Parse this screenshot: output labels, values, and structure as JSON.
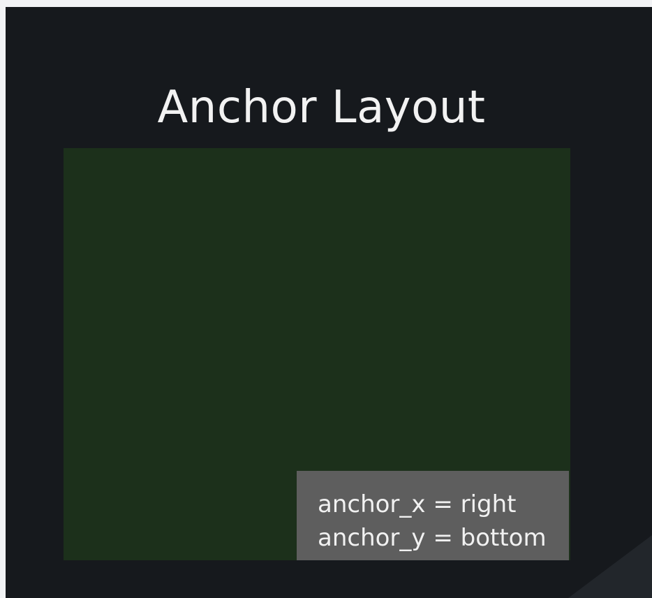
{
  "title": "Anchor Layout",
  "anchored_widget": {
    "line1": "anchor_x = right",
    "line2": "anchor_y = bottom"
  },
  "colors": {
    "window_background": "#16191d",
    "anchor_area_background": "#1c301b",
    "label_box_background": "#5e5e5e",
    "text": "#f2f2f2"
  }
}
